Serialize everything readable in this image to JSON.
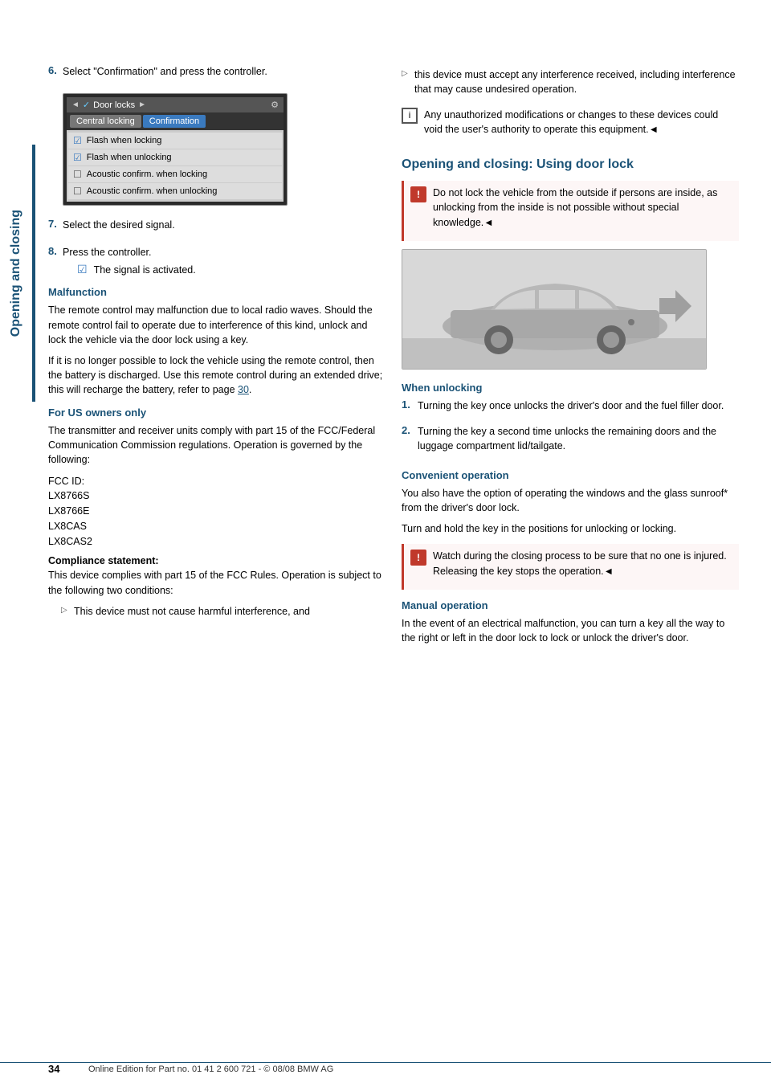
{
  "sidebar": {
    "label": "Opening and closing"
  },
  "left_column": {
    "step6": {
      "number": "6.",
      "text": "Select \"Confirmation\" and press the controller."
    },
    "ui_screenshot": {
      "header_left": "◄",
      "header_icon": "✓",
      "header_title": "Door locks",
      "header_right": "►",
      "tabs": [
        "Central locking",
        "Confirmation"
      ],
      "rows": [
        {
          "type": "checked",
          "label": "Flash when locking"
        },
        {
          "type": "checked",
          "label": "Flash when unlocking"
        },
        {
          "type": "unchecked",
          "label": "Acoustic confirm. when locking"
        },
        {
          "type": "unchecked",
          "label": "Acoustic confirm. when unlocking"
        }
      ]
    },
    "step7": {
      "number": "7.",
      "text": "Select the desired signal."
    },
    "step8": {
      "number": "8.",
      "text": "Press the controller."
    },
    "signal_activated": "The signal is activated.",
    "malfunction_heading": "Malfunction",
    "malfunction_text1": "The remote control may malfunction due to local radio waves. Should the remote control fail to operate due to interference of this kind, unlock and lock the vehicle via the door lock using a key.",
    "malfunction_text2": "If it is no longer possible to lock the vehicle using the remote control, then the battery is discharged. Use this remote control during an extended drive; this will recharge the battery, refer to page",
    "malfunction_page": "30",
    "malfunction_period": ".",
    "for_us_heading": "For US owners only",
    "for_us_text1": "The transmitter and receiver units comply with part 15 of the FCC/Federal Communication Commission regulations. Operation is governed by the following:",
    "fcc_ids": "FCC ID:\nLX8766S\nLX8766E\nLX8CAS\nLX8CAS2",
    "compliance_heading": "Compliance statement:",
    "compliance_text": "This device complies with part 15 of the FCC Rules. Operation is subject to the following two conditions:",
    "bullet1": "This device must not cause harmful interference, and"
  },
  "right_column": {
    "bullet2": "this device must accept any interference received, including interference that may cause undesired operation.",
    "note_text": "Any unauthorized modifications or changes to these devices could void the user's authority to operate this equipment.◄",
    "section_heading": "Opening and closing: Using door lock",
    "warning_text": "Do not lock the vehicle from the outside if persons are inside, as unlocking from the inside is not possible without special knowledge.◄",
    "when_unlocking_heading": "When unlocking",
    "unlock_step1": "Turning the key once unlocks the driver's door and the fuel filler door.",
    "unlock_step2": "Turning the key a second time unlocks the remaining doors and the luggage compartment lid/tailgate.",
    "convenient_heading": "Convenient operation",
    "convenient_text1": "You also have the option of operating the windows and the glass sunroof* from the driver's door lock.",
    "convenient_text2": "Turn and hold the key in the positions for unlocking or locking.",
    "convenient_warning": "Watch during the closing process to be sure that no one is injured. Releasing the key stops the operation.◄",
    "manual_heading": "Manual operation",
    "manual_text": "In the event of an electrical malfunction, you can turn a key all the way to the right or left in the door lock to lock or unlock the driver's door."
  },
  "footer": {
    "page_number": "34",
    "text": "Online Edition for Part no. 01 41 2 600 721 - © 08/08 BMW AG"
  }
}
